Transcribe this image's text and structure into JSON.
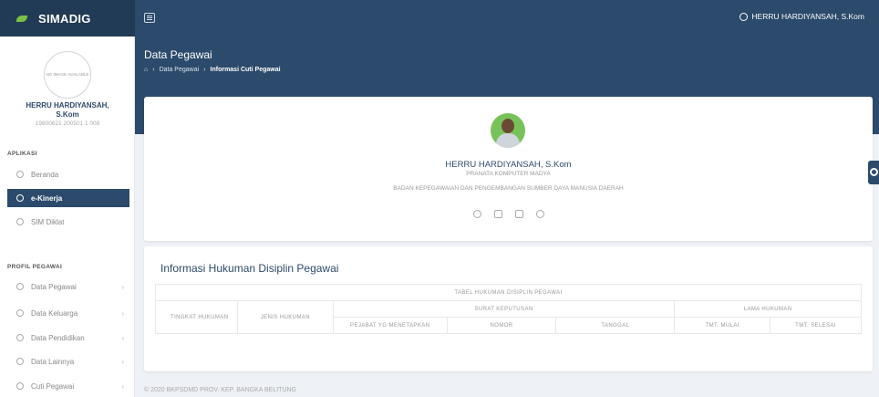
{
  "app": {
    "name": "SIMADIG"
  },
  "topbar": {
    "user": "HERRU HARDIYANSAH, S.Kom"
  },
  "sidebar": {
    "no_image": "NO IMAGE AVAILABLE",
    "user_name_line1": "HERRU HARDIYANSAH,",
    "user_name_line2": "S.Kom",
    "user_nip": "19800621 200501 1 008",
    "section_aplikasi": "APLIKASI",
    "section_profil": "PROFIL PEGAWAI",
    "items": [
      {
        "label": "Beranda",
        "icon": "home-icon"
      },
      {
        "label": "e-Kinerja",
        "icon": "target-icon"
      },
      {
        "label": "SIM Diklat",
        "icon": "book-icon"
      },
      {
        "label": "Data Pegawai",
        "icon": "user-icon"
      },
      {
        "label": "Data Keluarga",
        "icon": "family-icon"
      },
      {
        "label": "Data Pendidikan",
        "icon": "education-icon"
      },
      {
        "label": "Data Lainnya",
        "icon": "more-icon"
      },
      {
        "label": "Cuti Pegawai",
        "icon": "leave-icon"
      }
    ]
  },
  "page": {
    "title": "Data Pegawai",
    "breadcrumb": [
      "Data Pegawai",
      "Informasi Cuti Pegawai"
    ]
  },
  "profile": {
    "name": "HERRU HARDIYANSAH, S.Kom",
    "position": "PRANATA KOMPUTER MADYA",
    "organization": "BADAN KEPEGAWAIAN DAN PENGEMBANGAN SUMBER DAYA MANUSIA DAERAH"
  },
  "discipline": {
    "title": "Informasi Hukuman Disiplin Pegawai",
    "table_caption": "TABEL HUKUMAN DISIPLIN PEGAWAI",
    "col_tingkat": "TINGKAT HUKUMAN",
    "col_jenis": "JENIS HUKUMAN",
    "col_surat": "SURAT KEPUTUSAN",
    "col_lama": "LAMA HUKUMAN",
    "col_pejabat": "PEJABAT YG MENETAPKAN",
    "col_nomor": "NOMOR",
    "col_tanggal": "TANGGAL",
    "col_tmt_mulai": "TMT. MULAI",
    "col_tmt_selesai": "TMT. SELESAI"
  },
  "footer": "© 2020 BKPSDMD PROV. KEP. BANGKA BELITUNG",
  "colors": {
    "primary": "#2c4a6b",
    "accent": "#7ac143"
  }
}
